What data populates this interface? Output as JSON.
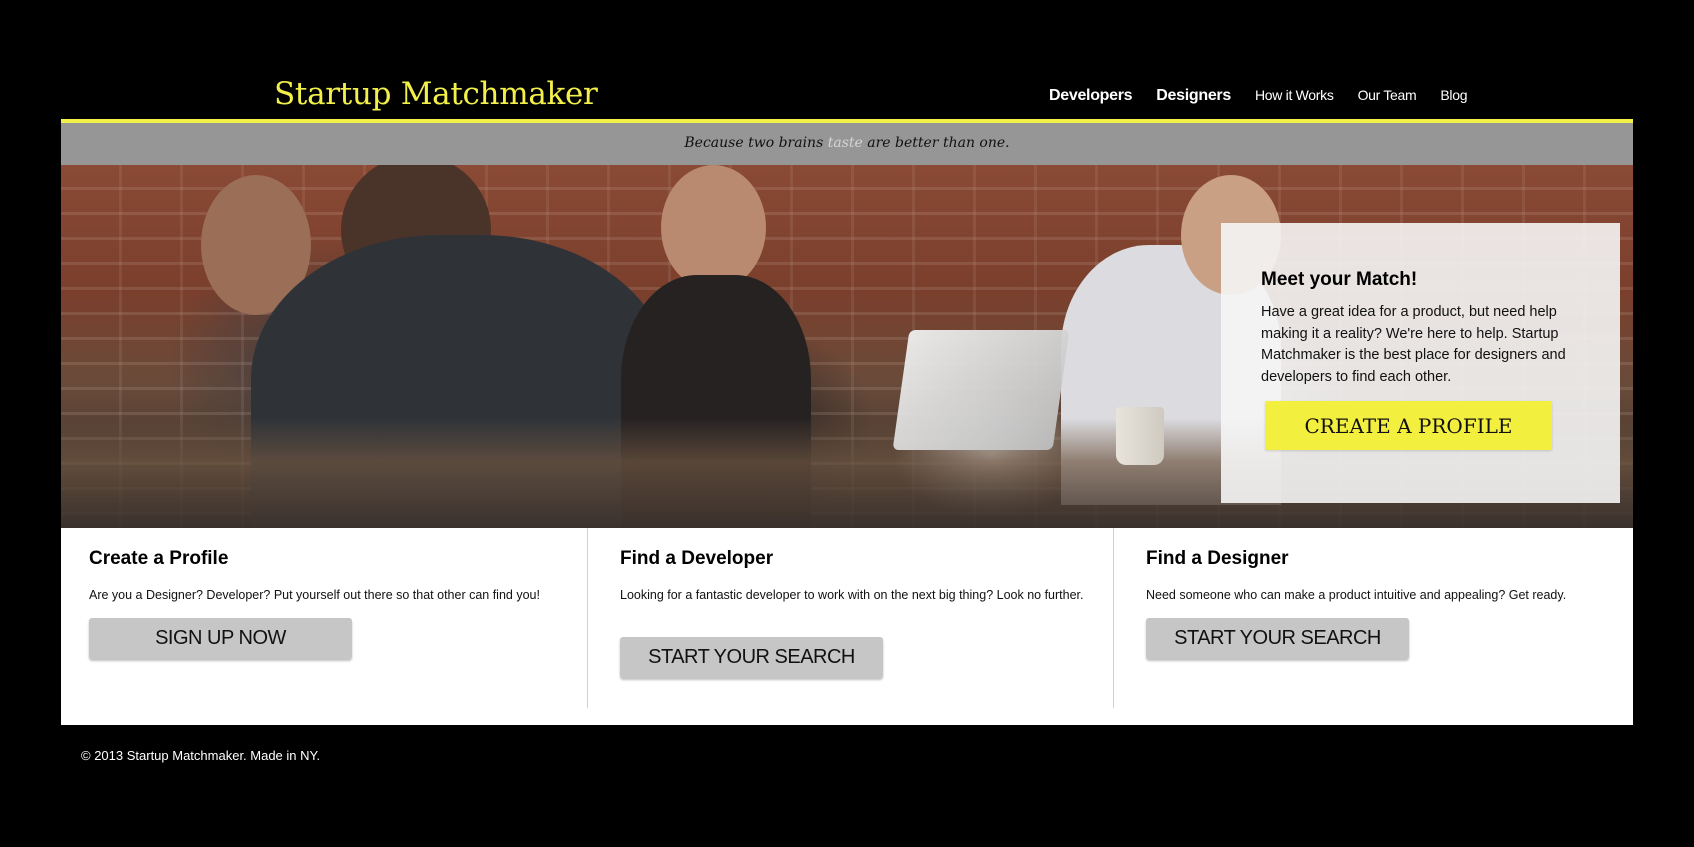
{
  "header": {
    "logo": "Startup Matchmaker",
    "nav": [
      {
        "label": "Developers"
      },
      {
        "label": "Designers"
      },
      {
        "label": "How it Works"
      },
      {
        "label": "Our Team"
      },
      {
        "label": "Blog"
      }
    ]
  },
  "tagline": {
    "before": "Because two brains",
    "ghost": "taste",
    "after": "are better than one."
  },
  "hero": {
    "cta_title": "Meet your Match!",
    "cta_text": "Have a great idea for a product, but need help making it a reality? We're here to help. Startup Matchmaker is the best place for designers and developers to find each other.",
    "cta_button": "CREATE A PROFILE"
  },
  "features": [
    {
      "title": "Create a Profile",
      "text": "Are you a Designer? Developer? Put yourself out there so that other can find you!",
      "button": "SIGN UP NOW"
    },
    {
      "title": "Find a Developer",
      "text": "Looking for a fantastic developer to work with on the next big thing? Look no further.",
      "button": "START YOUR SEARCH"
    },
    {
      "title": "Find a Designer",
      "text": "Need someone who can make a product intuitive and appealing? Get ready.",
      "button": "START YOUR SEARCH"
    }
  ],
  "footer": {
    "text": "© 2013 Startup Matchmaker. Made in NY."
  },
  "colors": {
    "accent": "#f3f04a",
    "background": "#000000",
    "tagline_bar": "#969696",
    "button_gray": "#c6c6c6"
  }
}
